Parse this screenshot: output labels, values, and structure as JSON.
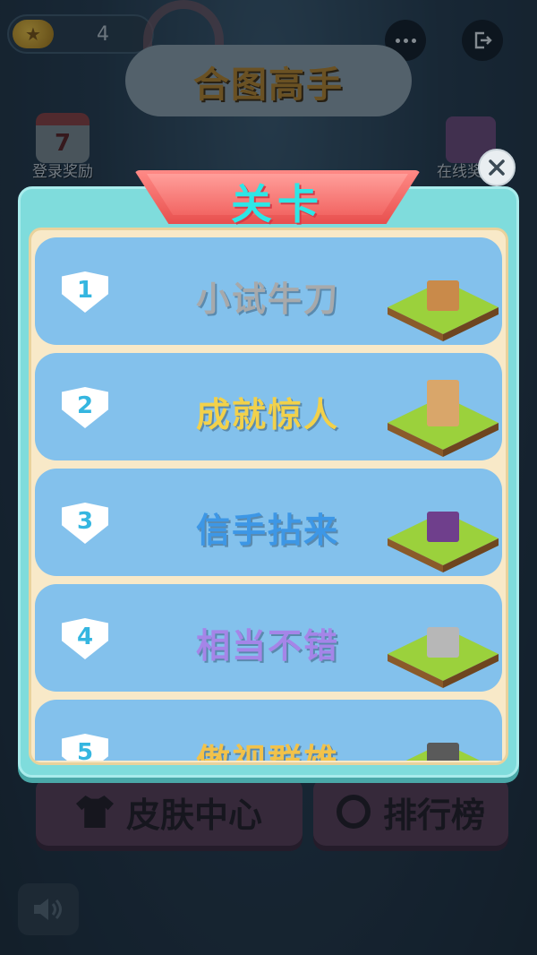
{
  "hud": {
    "coins": "4",
    "more_icon": "more-dots-icon",
    "exit_icon": "exit-icon"
  },
  "game": {
    "title": "合图高手"
  },
  "side": {
    "login_reward": "登录奖励",
    "login_day": "7",
    "online_reward": "在线奖励"
  },
  "popup": {
    "title": "关卡",
    "close_icon": "close-icon",
    "levels": [
      {
        "number": "1",
        "name": "小试牛刀",
        "color": "#a7a9ab"
      },
      {
        "number": "2",
        "name": "成就惊人",
        "color": "#f2d14a"
      },
      {
        "number": "3",
        "name": "信手拈来",
        "color": "#3d97e6"
      },
      {
        "number": "4",
        "name": "相当不错",
        "color": "#a585e8"
      },
      {
        "number": "5",
        "name": "傲视群雄",
        "color": "#f2c24a"
      }
    ]
  },
  "bottom": {
    "skin_label": "皮肤中心",
    "rank_label": "排行榜"
  },
  "colors": {
    "popup_bg": "#7fdcdc",
    "row_bg": "#83c1ec",
    "header_red": "#f26663",
    "title_cyan": "#2ee6e6"
  }
}
